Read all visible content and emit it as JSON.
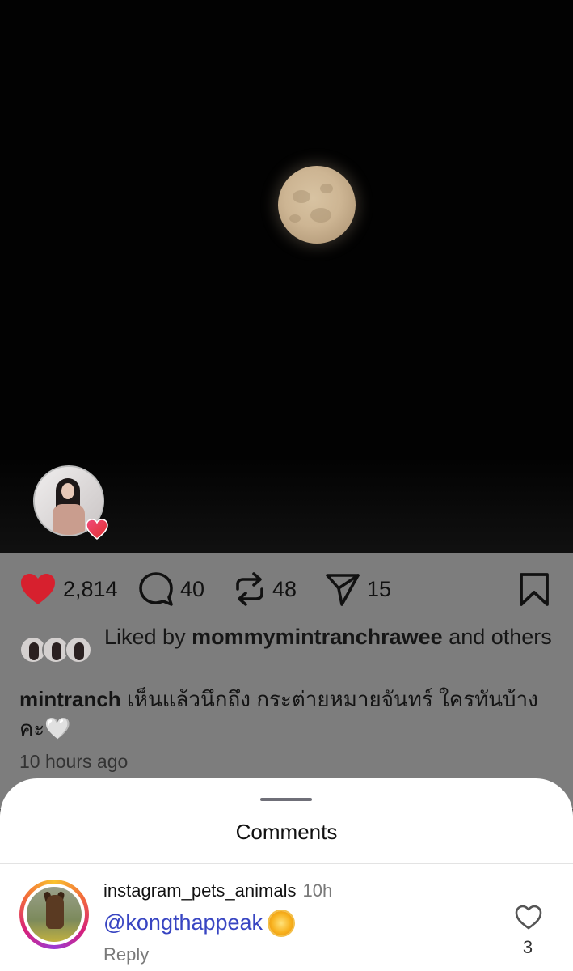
{
  "post": {
    "likes": "2,814",
    "comments": "40",
    "reposts": "48",
    "shares": "15",
    "liked_by_prefix": "Liked by ",
    "liked_by_user": "mommymintranchrawee",
    "liked_by_suffix": " and others",
    "author": "mintranch",
    "caption": "เห็นแล้วนึกถึง กระต่ายหมายจันทร์ ใครทันบ้างคะ🤍",
    "time": "10 hours ago"
  },
  "sheet": {
    "title": "Comments"
  },
  "comment": {
    "username": "instagram_pets_animals",
    "time": "10h",
    "mention": "@kongthappeak",
    "reply_label": "Reply",
    "like_count": "3"
  },
  "icons": {
    "like": "heart-filled-icon",
    "comment": "speech-bubble-icon",
    "repost": "repost-icon",
    "share": "paper-plane-icon",
    "save": "bookmark-icon"
  },
  "colors": {
    "heart": "#e02030",
    "mention": "#3845c2"
  }
}
